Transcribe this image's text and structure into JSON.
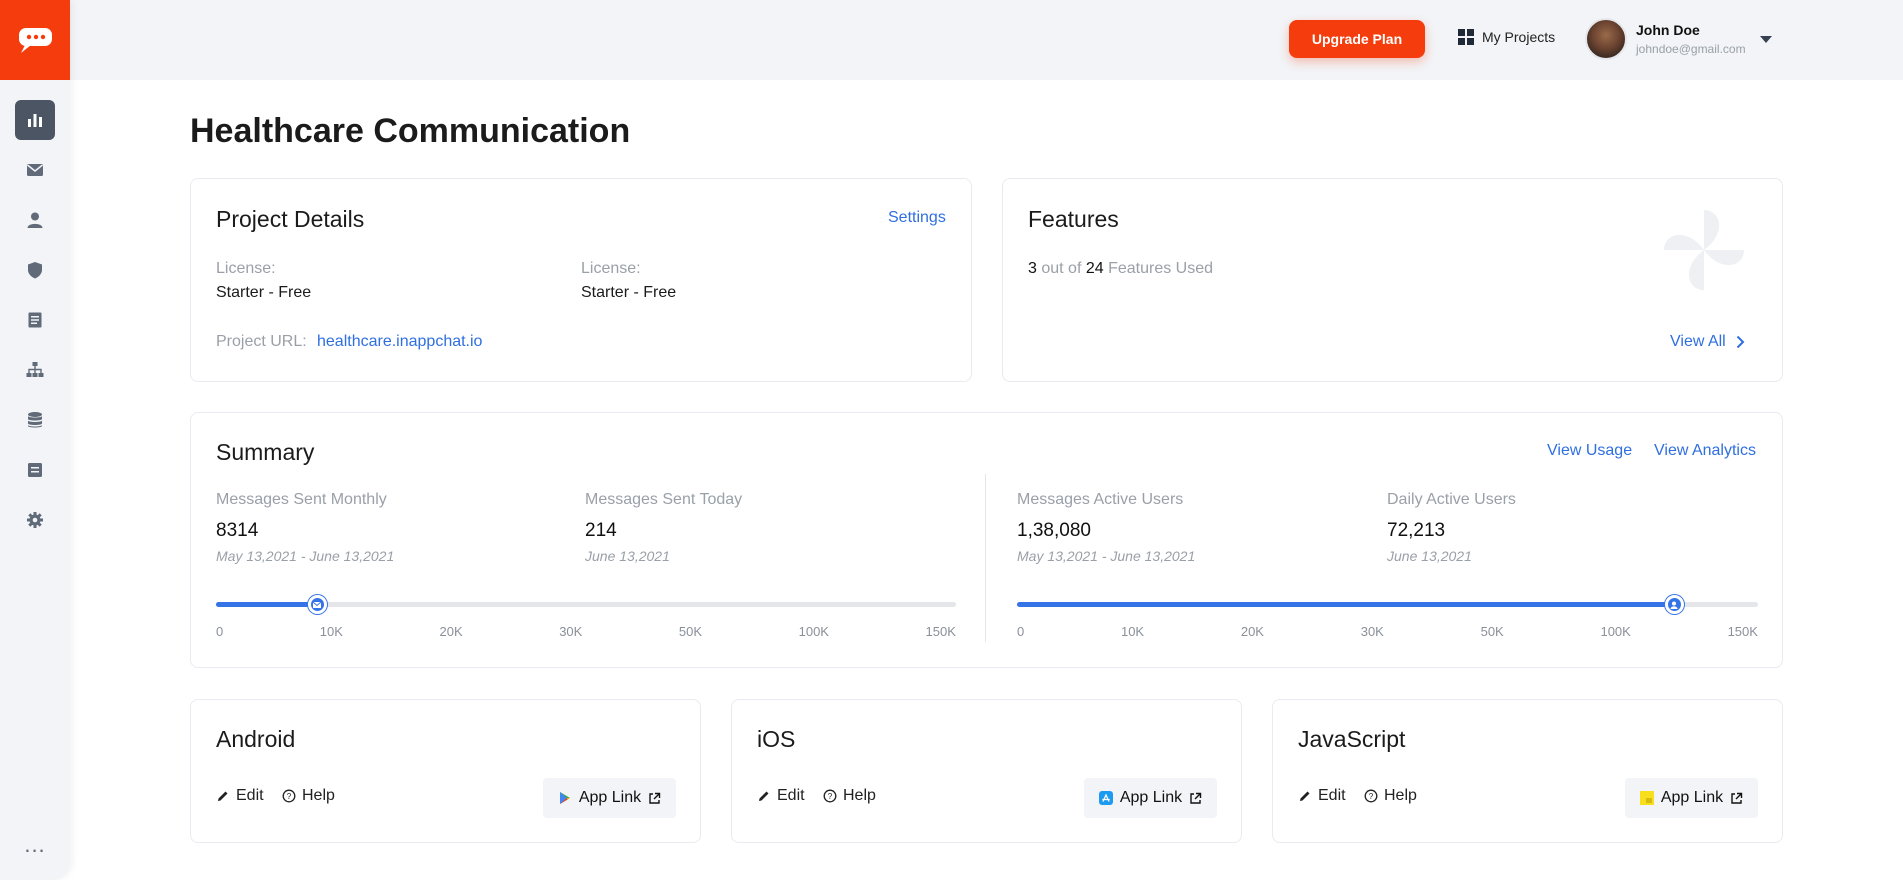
{
  "header": {
    "upgrade_label": "Upgrade Plan",
    "my_projects_label": "My Projects",
    "user_name": "John Doe",
    "user_email": "johndoe@gmail.com"
  },
  "sidebar": {
    "items": [
      {
        "icon": "bar-chart-icon",
        "active": true
      },
      {
        "icon": "mail-icon"
      },
      {
        "icon": "user-icon"
      },
      {
        "icon": "shield-icon"
      },
      {
        "icon": "document-icon"
      },
      {
        "icon": "hierarchy-icon"
      },
      {
        "icon": "database-icon"
      },
      {
        "icon": "note-icon"
      },
      {
        "icon": "gear-icon"
      }
    ],
    "more_label": "..."
  },
  "page": {
    "title": "Healthcare Communication"
  },
  "project_details": {
    "title": "Project Details",
    "settings_label": "Settings",
    "license1_label": "License:",
    "license1_value": "Starter - Free",
    "license2_label": "License:",
    "license2_value": "Starter - Free",
    "url_label": "Project URL:",
    "url_value": "healthcare.inappchat.io"
  },
  "features": {
    "title": "Features",
    "used": "3",
    "out_of_text": "out of",
    "total": "24",
    "features_used_text": "Features Used",
    "view_all_label": "View All"
  },
  "summary": {
    "title": "Summary",
    "view_usage_label": "View Usage",
    "view_analytics_label": "View Analytics",
    "stats": [
      {
        "title": "Messages Sent Monthly",
        "value": "8314",
        "range": "May 13,2021 - June 13,2021"
      },
      {
        "title": "Messages Sent Today",
        "value": "214",
        "range": "June 13,2021"
      },
      {
        "title": "Messages Active Users",
        "value": "1,38,080",
        "range": "May 13,2021 - June 13,2021"
      },
      {
        "title": "Daily Active Users",
        "value": "72,213",
        "range": "June 13,2021"
      }
    ],
    "sliders": [
      {
        "fill_fraction": 0.137,
        "ticks": [
          "0",
          "10K",
          "20K",
          "30K",
          "50K",
          "100K",
          "150K"
        ]
      },
      {
        "fill_fraction": 0.887,
        "ticks": [
          "0",
          "10K",
          "20K",
          "30K",
          "50K",
          "100K",
          "150K"
        ]
      }
    ]
  },
  "platforms": [
    {
      "title": "Android",
      "edit_label": "Edit",
      "help_label": "Help",
      "app_link_label": "App Link",
      "icon": "google-play-icon"
    },
    {
      "title": "iOS",
      "edit_label": "Edit",
      "help_label": "Help",
      "app_link_label": "App Link",
      "icon": "app-store-icon"
    },
    {
      "title": "JavaScript",
      "edit_label": "Edit",
      "help_label": "Help",
      "app_link_label": "App Link",
      "icon": "javascript-icon"
    }
  ],
  "colors": {
    "brand": "#f53c0c",
    "link": "#2f6fe0",
    "slider": "#3574e6",
    "sidebar_bg": "#f2f4f7"
  }
}
